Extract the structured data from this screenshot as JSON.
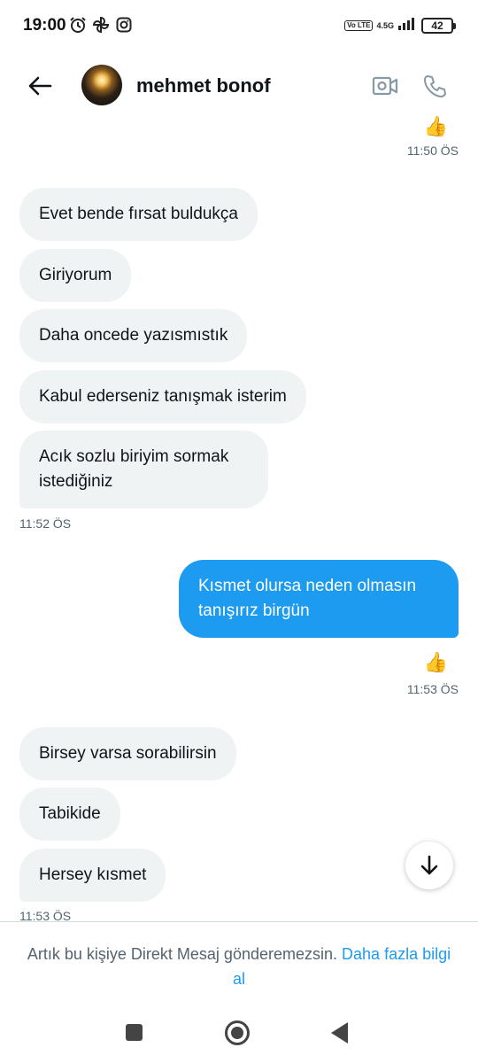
{
  "status_bar": {
    "time": "19:00",
    "network": "4.5G",
    "volte": "Vo LTE",
    "battery": "42"
  },
  "header": {
    "contact_name": "mehmet bonof"
  },
  "messages": {
    "reaction_1": "👍",
    "time_1": "11:50 ÖS",
    "incoming_1": [
      "Evet bende fırsat buldukça",
      "Giriyorum",
      "Daha oncede yazısmıstık",
      "Kabul ederseniz tanışmak isterim",
      "Acık sozlu biriyim sormak istediğiniz"
    ],
    "time_2": "11:52 ÖS",
    "outgoing_1": "Kısmet olursa neden olmasın tanışırız birgün",
    "reaction_2": "👍",
    "time_3": "11:53 ÖS",
    "incoming_2": [
      "Birsey varsa sorabilirsin",
      "Tabikide",
      "Hersey kısmet"
    ],
    "time_4": "11:53 ÖS"
  },
  "footer": {
    "notice": "Artık bu kişiye Direkt Mesaj gönderemezsin.",
    "link": "Daha fazla bilgi al"
  },
  "colors": {
    "accent": "#1d9bf0",
    "incoming_bubble": "#eff3f4",
    "muted_text": "#536471"
  }
}
